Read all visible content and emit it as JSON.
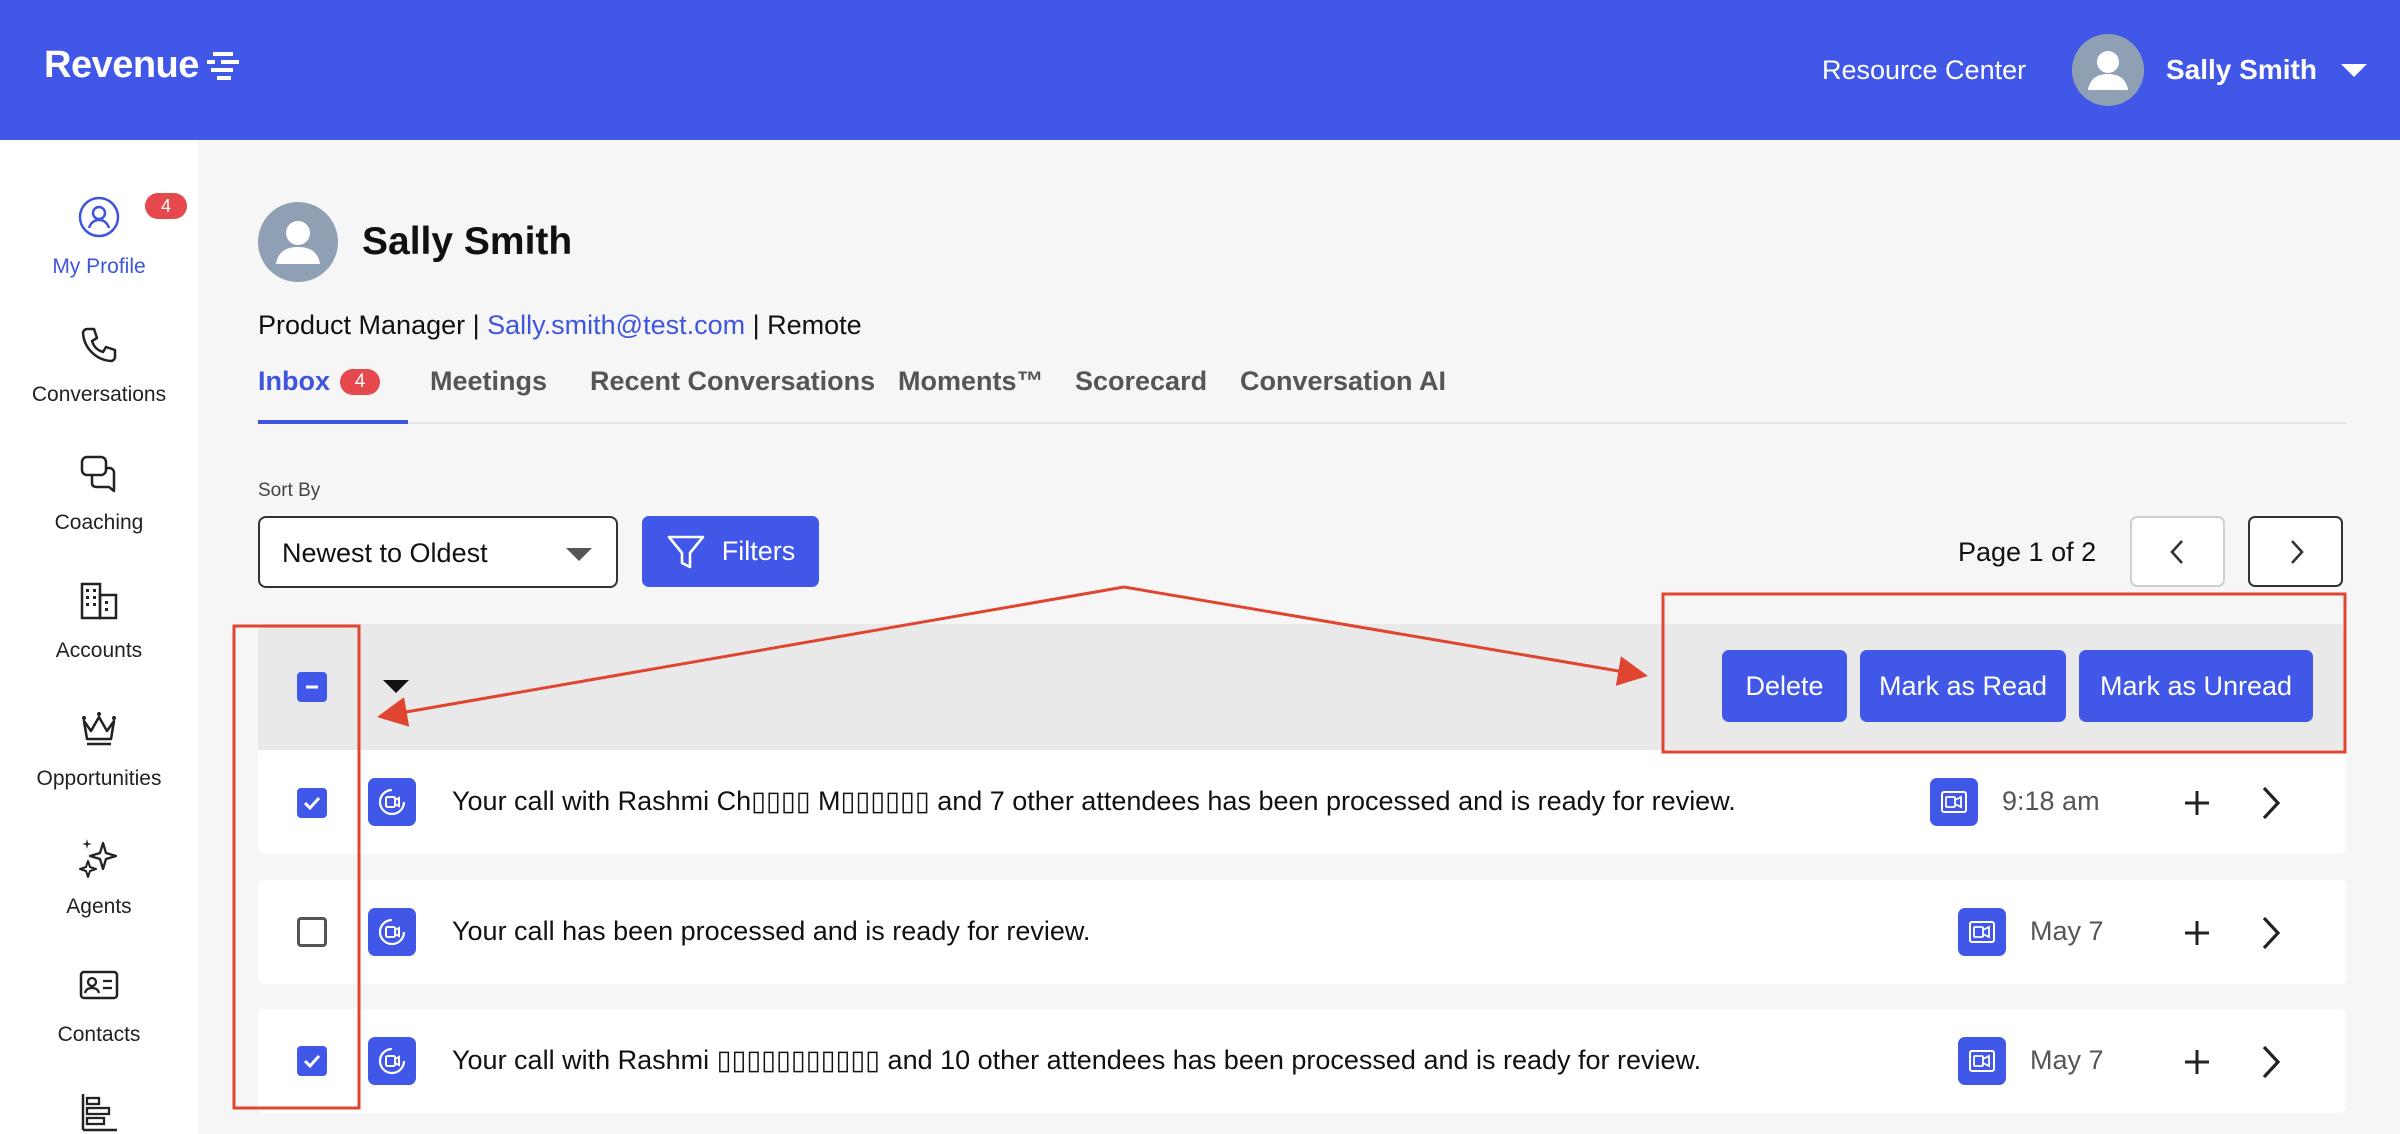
{
  "header": {
    "logo_text": "Revenue",
    "resource_center": "Resource Center",
    "user_name": "Sally Smith",
    "colors": {
      "bar": "#4157e8",
      "text": "#ffffff"
    }
  },
  "sidebar": {
    "items": [
      {
        "label": "My Profile",
        "icon": "user-circle-icon",
        "badge": "4",
        "active": true
      },
      {
        "label": "Conversations",
        "icon": "phone-icon"
      },
      {
        "label": "Coaching",
        "icon": "chat-bubbles-icon"
      },
      {
        "label": "Accounts",
        "icon": "building-icon"
      },
      {
        "label": "Opportunities",
        "icon": "crown-icon"
      },
      {
        "label": "Agents",
        "icon": "sparkles-icon"
      },
      {
        "label": "Contacts",
        "icon": "contact-card-icon"
      },
      {
        "label": "",
        "icon": "bar-chart-icon"
      }
    ]
  },
  "profile": {
    "name": "Sally Smith",
    "title": "Product Manager",
    "separator": " | ",
    "email": "Sally.smith@test.com",
    "location": "Remote"
  },
  "tabs": [
    {
      "label": "Inbox",
      "badge": "4",
      "active": true
    },
    {
      "label": "Meetings"
    },
    {
      "label": "Recent Conversations"
    },
    {
      "label": "Moments™"
    },
    {
      "label": "Scorecard"
    },
    {
      "label": "Conversation AI"
    }
  ],
  "toolbar": {
    "sort_label": "Sort By",
    "sort_value": "Newest to Oldest",
    "filters_label": "Filters",
    "page_text": "Page 1 of 2"
  },
  "bulk_actions": {
    "select_all_state": "partial",
    "buttons": [
      "Delete",
      "Mark as Read",
      "Mark as Unread"
    ]
  },
  "inbox_rows": [
    {
      "checked": true,
      "text": "Your call with Rashmi Ch▯▯▯▯ M▯▯▯▯▯▯ and 7 other attendees has been processed and is ready for review.",
      "time": "9:18 am"
    },
    {
      "checked": false,
      "text": "Your call has been processed and is ready for review.",
      "time": "May 7"
    },
    {
      "checked": true,
      "text": "Your call with Rashmi ▯▯▯▯▯▯▯▯▯▯▯ and 10 other attendees has been processed and is ready for review.",
      "time": "May 7"
    }
  ],
  "annotation_color": "#e0452f"
}
